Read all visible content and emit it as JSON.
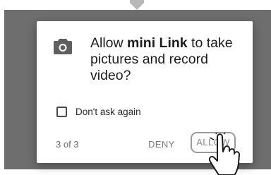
{
  "dialog": {
    "icon": "camera-icon",
    "message_prefix": "Allow ",
    "app_name": "mini Link",
    "message_suffix": " to take pictures and record video?",
    "checkbox_label": "Don't ask again",
    "checkbox_checked": false,
    "counter": "3 of 3",
    "deny_label": "DENY",
    "allow_label": "ALLOW"
  },
  "overlay": {
    "pointer_icon": "hand-pointer-icon",
    "top_icon": "chevron-down-icon"
  },
  "colors": {
    "backdrop": "#6e6e6e",
    "dialog_bg": "#ffffff",
    "text": "#1c1c1c",
    "muted": "#7a7a7a"
  }
}
